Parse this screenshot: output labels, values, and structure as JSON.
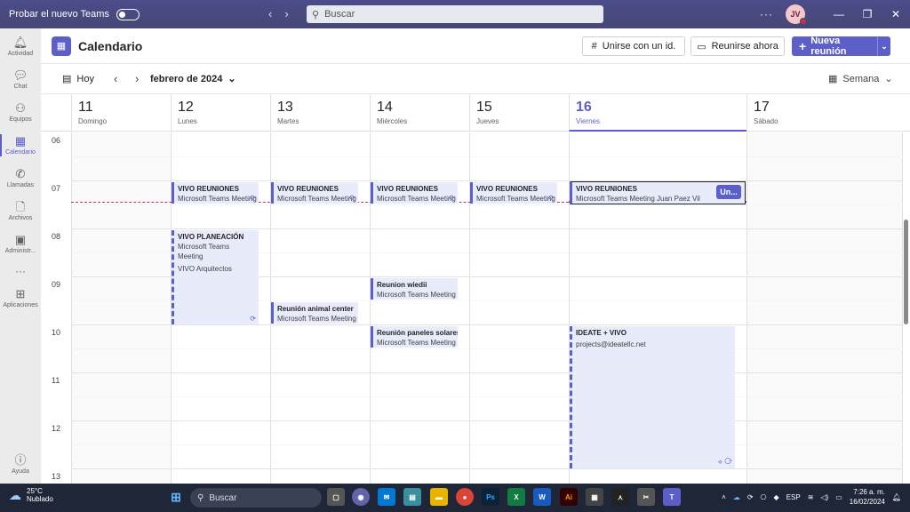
{
  "titlebar": {
    "try_new_teams": "Probar el nuevo Teams",
    "search_placeholder": "Buscar",
    "avatar_initials": "JV",
    "more": "···"
  },
  "rail": [
    {
      "label": "Actividad",
      "icon": "bell-icon",
      "glyph": "🔔"
    },
    {
      "label": "Chat",
      "icon": "chat-icon",
      "glyph": "💬"
    },
    {
      "label": "Equipos",
      "icon": "teams-icon",
      "glyph": "👥"
    },
    {
      "label": "Calendario",
      "icon": "calendar-icon",
      "glyph": "📅"
    },
    {
      "label": "Llamadas",
      "icon": "phone-icon",
      "glyph": "📞"
    },
    {
      "label": "Archivos",
      "icon": "file-icon",
      "glyph": "📄"
    },
    {
      "label": "Administr...",
      "icon": "admin-icon",
      "glyph": "🅰"
    },
    {
      "label": "Aplicaciones",
      "icon": "apps-icon",
      "glyph": "⊞"
    },
    {
      "label": "Ayuda",
      "icon": "help-icon",
      "glyph": "?"
    }
  ],
  "header": {
    "title": "Calendario",
    "join_id": "Unirse con un id.",
    "meet_now": "Reunirse ahora",
    "new_meeting": "Nueva reunión"
  },
  "toolbar": {
    "today": "Hoy",
    "month": "febrero de 2024",
    "view": "Semana"
  },
  "days": [
    {
      "num": "11",
      "name": "Domingo"
    },
    {
      "num": "12",
      "name": "Lunes"
    },
    {
      "num": "13",
      "name": "Martes"
    },
    {
      "num": "14",
      "name": "Miércoles"
    },
    {
      "num": "15",
      "name": "Jueves"
    },
    {
      "num": "16",
      "name": "Viernes"
    },
    {
      "num": "17",
      "name": "Sábado"
    }
  ],
  "hours": [
    "06",
    "07",
    "08",
    "09",
    "10",
    "11",
    "12",
    "13"
  ],
  "events": {
    "reuniones_title": "VIVO REUNIONES",
    "teams_meeting": "Microsoft Teams Meeting",
    "teams_meeting_juan": "Microsoft Teams Meeting  Juan  Paez Vil",
    "join_short": "Un...",
    "planeacion_title": "VIVO PLANEACIÓN",
    "planeacion_loc": "VIVO Arquitectos",
    "animal_title": "Reunión animal center",
    "wiedii_title": "Reunion wiedii",
    "paneles_title": "Reunión paneles solares",
    "ideate_title": "IDEATE + VIVO",
    "ideate_email": "projects@ideatellc.net"
  },
  "taskbar": {
    "temp": "25°C",
    "weather": "Nublado",
    "search": "Buscar",
    "lang": "ESP",
    "time": "7:26 a. m.",
    "date": "16/02/2024"
  }
}
